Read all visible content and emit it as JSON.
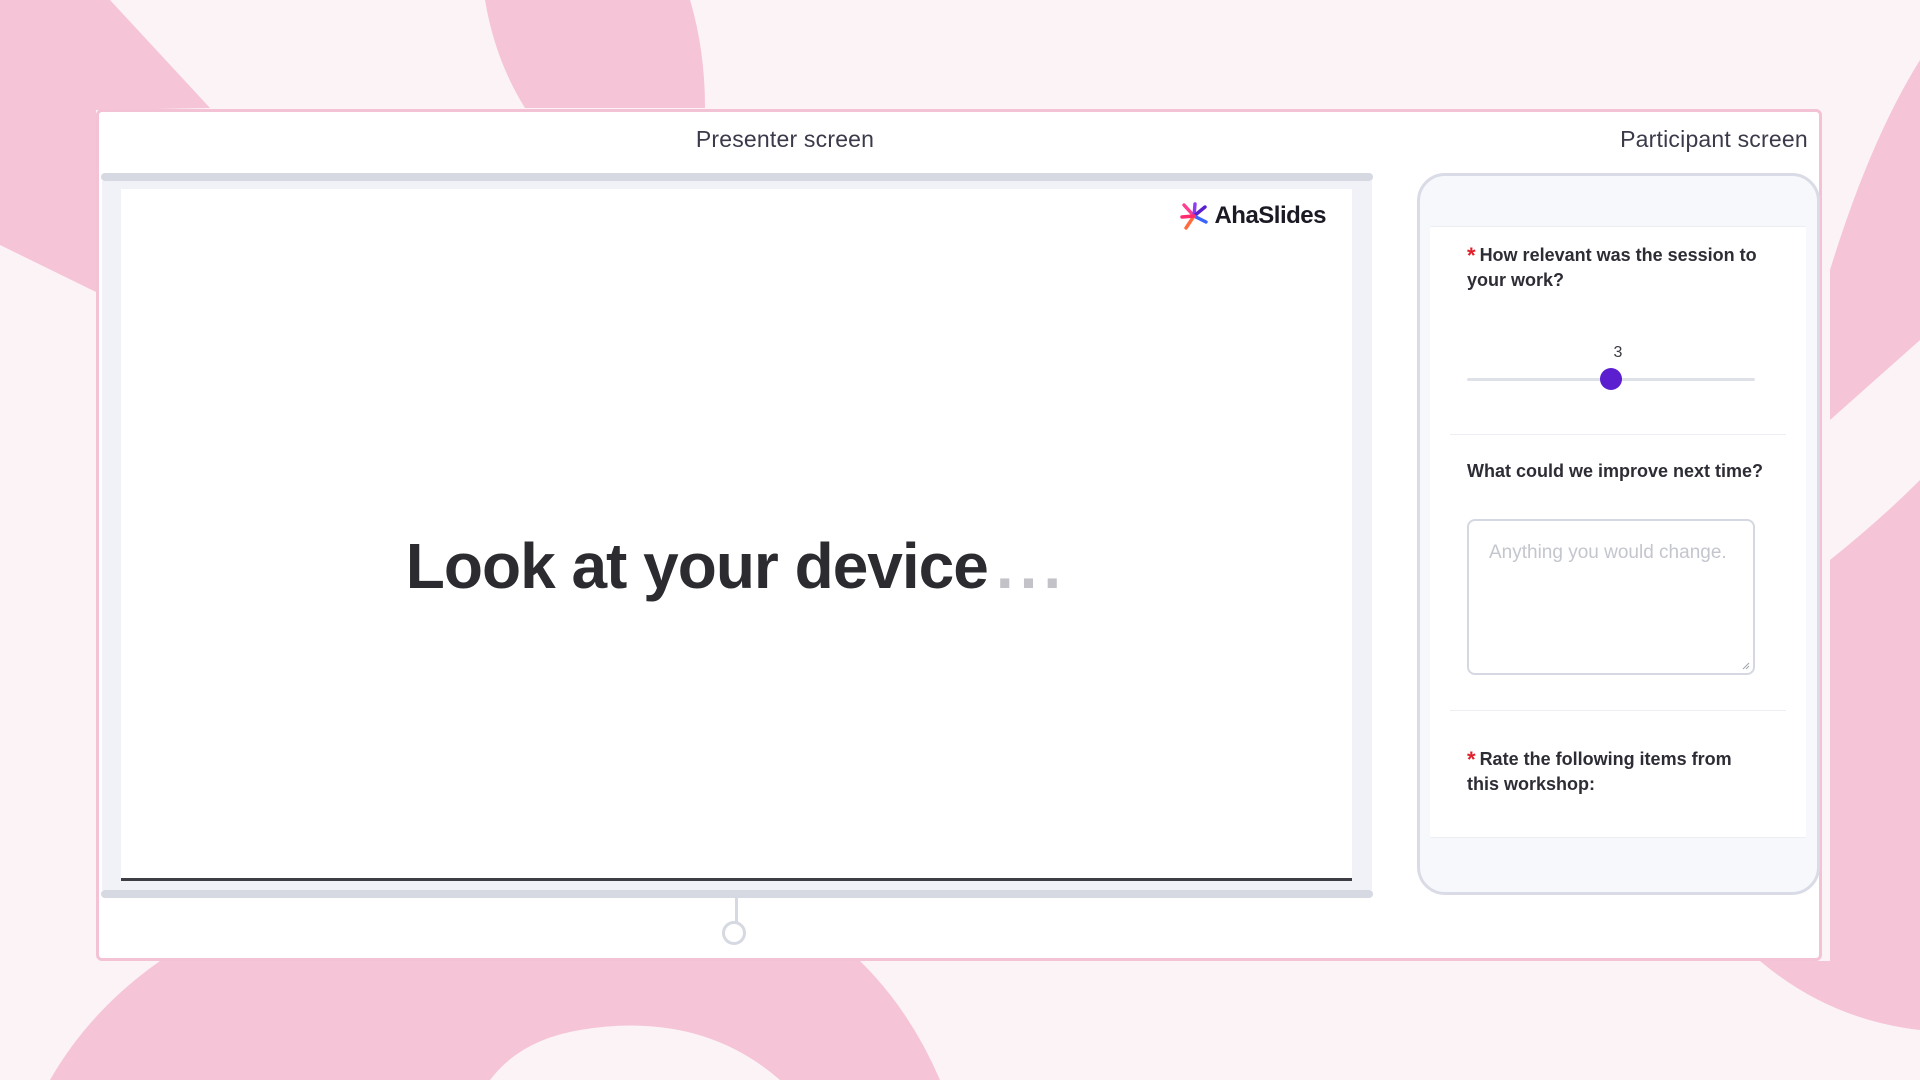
{
  "panes": {
    "presenter_title": "Presenter screen",
    "participant_title": "Participant screen"
  },
  "slide": {
    "brand": "AhaSlides",
    "heading": "Look at your device",
    "ellipsis": "..."
  },
  "phone": {
    "q1": {
      "required_mark": "*",
      "text": "How relevant was the session to your work?",
      "slider_value": "3",
      "slider_level": 0.5
    },
    "q2": {
      "text": "What could we improve next time?",
      "placeholder": "Anything you would change."
    },
    "q3": {
      "required_mark": "*",
      "text": "Rate the following items from this workshop:"
    }
  },
  "colors": {
    "background": "#fcf3f7",
    "blob": "#f5c4d6",
    "accent": "#5b1fd0",
    "required": "#e0202a"
  }
}
